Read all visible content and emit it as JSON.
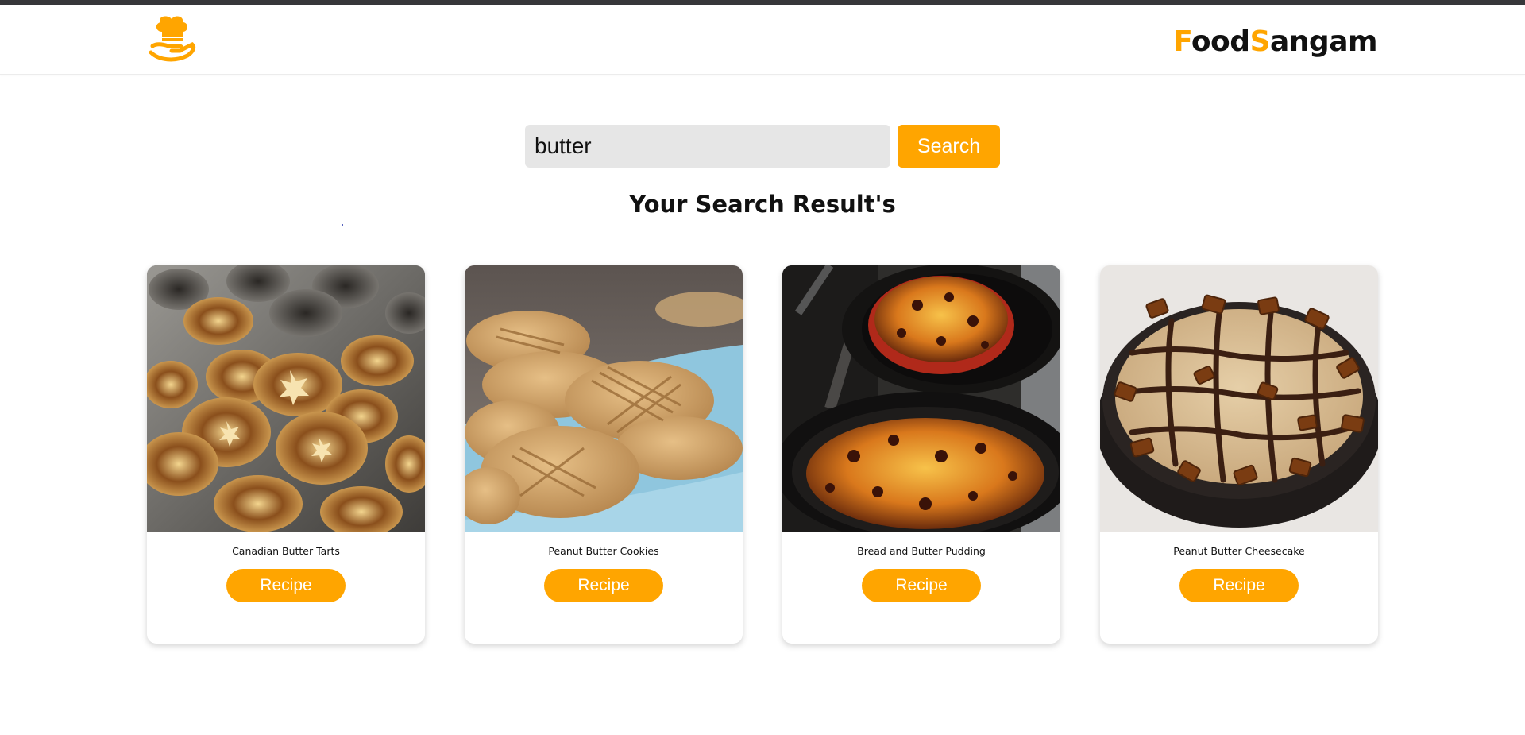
{
  "header": {
    "logo_icon": "chef-hat-serving-hand-icon",
    "brand_first_letter": "F",
    "brand_rest_1": "ood",
    "brand_second_letter": "S",
    "brand_rest_2": "angam"
  },
  "search": {
    "value": "butter",
    "button_label": "Search"
  },
  "results": {
    "heading": "Your Search Result's",
    "items": [
      {
        "title": "Canadian Butter Tarts",
        "button_label": "Recipe"
      },
      {
        "title": "Peanut Butter Cookies",
        "button_label": "Recipe"
      },
      {
        "title": "Bread and Butter Pudding",
        "button_label": "Recipe"
      },
      {
        "title": "Peanut Butter Cheesecake",
        "button_label": "Recipe"
      }
    ]
  },
  "colors": {
    "accent": "#ffa500",
    "top_strip": "#37373a",
    "search_field_bg": "#e6e6e6"
  }
}
